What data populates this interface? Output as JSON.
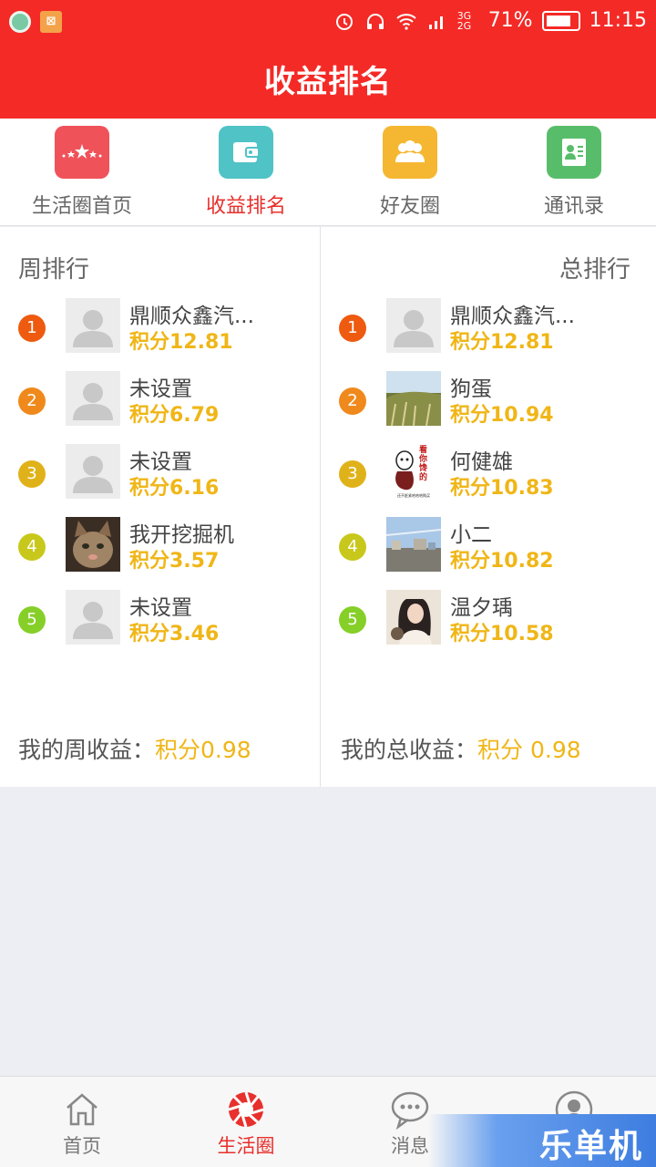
{
  "status_bar": {
    "battery": "71%",
    "time": "11:15",
    "network": "3G 2G"
  },
  "header": {
    "title": "收益排名"
  },
  "top_nav": [
    {
      "label": "生活圈首页",
      "icon": "stars-icon",
      "color": "#f0525a"
    },
    {
      "label": "收益排名",
      "icon": "wallet-icon",
      "color": "#4fc3c6"
    },
    {
      "label": "好友圈",
      "icon": "group-icon",
      "color": "#f5b731"
    },
    {
      "label": "通讯录",
      "icon": "contact-card-icon",
      "color": "#58bd6a"
    }
  ],
  "weekly": {
    "title": "周排行",
    "rows": [
      {
        "rank": "1",
        "name": "鼎顺众鑫汽...",
        "score": "积分12.81",
        "avatar": "default"
      },
      {
        "rank": "2",
        "name": "未设置",
        "score": "积分6.79",
        "avatar": "default"
      },
      {
        "rank": "3",
        "name": "未设置",
        "score": "积分6.16",
        "avatar": "default"
      },
      {
        "rank": "4",
        "name": "我开挖掘机",
        "score": "积分3.57",
        "avatar": "cat"
      },
      {
        "rank": "5",
        "name": "未设置",
        "score": "积分3.46",
        "avatar": "default"
      }
    ],
    "my_label": "我的周收益：",
    "my_value": "积分0.98"
  },
  "total": {
    "title": "总排行",
    "rows": [
      {
        "rank": "1",
        "name": "鼎顺众鑫汽...",
        "score": "积分12.81",
        "avatar": "default"
      },
      {
        "rank": "2",
        "name": "狗蛋",
        "score": "积分10.94",
        "avatar": "field"
      },
      {
        "rank": "3",
        "name": "何健雄",
        "score": "积分10.83",
        "avatar": "meme"
      },
      {
        "rank": "4",
        "name": "小二",
        "score": "积分10.82",
        "avatar": "city"
      },
      {
        "rank": "5",
        "name": "温夕瑀",
        "score": "积分10.58",
        "avatar": "girl"
      }
    ],
    "my_label": "我的总收益：",
    "my_value": "积分 0.98"
  },
  "meme_avatar": {
    "top": "看你馋的",
    "bottom": "还不赶紧哈哈哈购买"
  },
  "rank_colors": [
    "#ee5a0f",
    "#f0891c",
    "#e0b21a",
    "#c8c81c",
    "#86cf28"
  ],
  "tab_bar": [
    {
      "label": "首页",
      "icon": "home-icon"
    },
    {
      "label": "生活圈",
      "icon": "aperture-icon"
    },
    {
      "label": "消息",
      "icon": "chat-bubble-icon"
    },
    {
      "label": "",
      "icon": "profile-icon"
    }
  ],
  "watermark": "乐单机"
}
